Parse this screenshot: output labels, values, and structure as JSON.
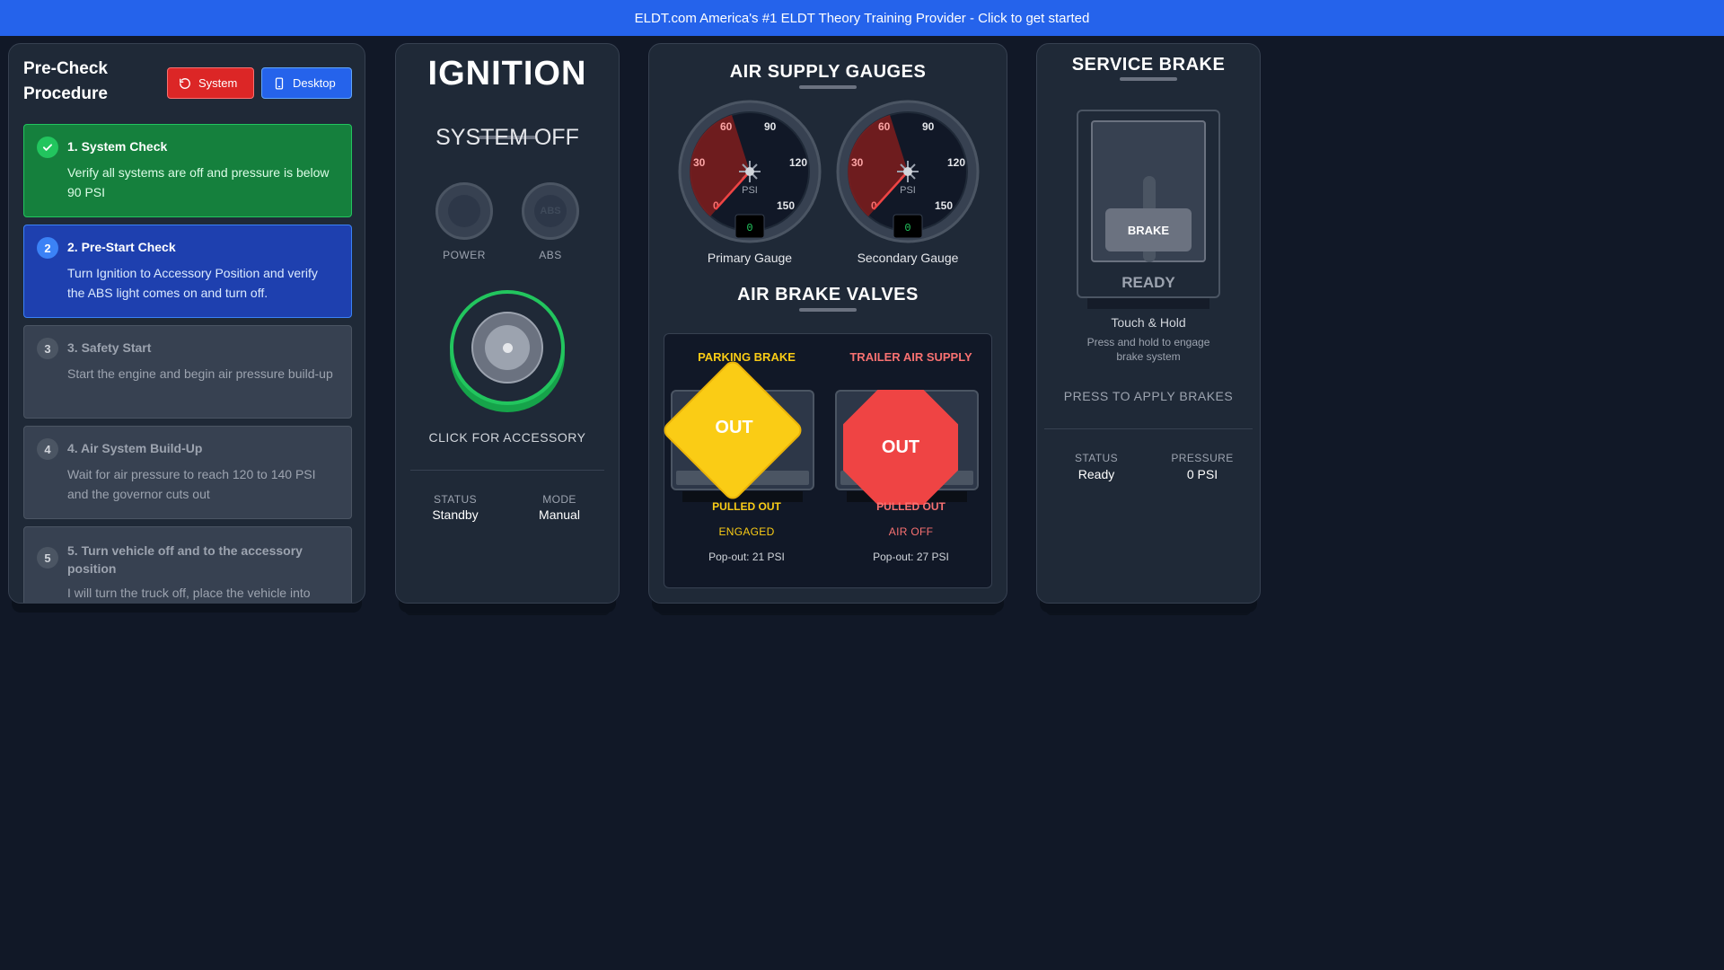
{
  "banner": {
    "text": "ELDT.com America's #1 ELDT Theory Training Provider - Click to get started"
  },
  "precheck": {
    "title": "Pre-Check Procedure",
    "system_button": "System",
    "desktop_button": "Desktop",
    "steps": [
      {
        "num": "1",
        "title": "1. System Check",
        "desc": "Verify all systems are off and pressure is below 90 PSI",
        "state": "done"
      },
      {
        "num": "2",
        "title": "2. Pre-Start Check",
        "desc": "Turn Ignition to Accessory Position and verify the ABS light comes on and turn off.",
        "state": "active"
      },
      {
        "num": "3",
        "title": "3. Safety Start",
        "desc": "Start the engine and begin air pressure build-up",
        "state": "pending"
      },
      {
        "num": "4",
        "title": "4. Air System Build-Up",
        "desc": "Wait for air pressure to reach 120 to 140 PSI and the governor cuts out",
        "state": "pending"
      },
      {
        "num": "5",
        "title": "5. Turn vehicle off and to the accessory position",
        "desc": "I will turn the truck off, place the vehicle into",
        "state": "pending"
      }
    ]
  },
  "ignition": {
    "title": "IGNITION",
    "system_state": "SYSTEM OFF",
    "power_label": "POWER",
    "abs_label": "ABS",
    "abs_icon_text": "ABS",
    "hint": "CLICK FOR ACCESSORY",
    "status_label": "STATUS",
    "status_value": "Standby",
    "mode_label": "MODE",
    "mode_value": "Manual"
  },
  "air_supply": {
    "title": "AIR SUPPLY GAUGES",
    "unit": "PSI",
    "tick_labels": [
      "0",
      "30",
      "60",
      "90",
      "120",
      "150"
    ],
    "gauges": [
      {
        "label": "Primary Gauge",
        "value": "0"
      },
      {
        "label": "Secondary Gauge",
        "value": "0"
      }
    ]
  },
  "valves": {
    "title": "AIR BRAKE VALVES",
    "parking": {
      "title": "PARKING BRAKE",
      "knob": "OUT",
      "status": "PULLED OUT",
      "state": "ENGAGED",
      "popout": "Pop-out: 21 PSI"
    },
    "trailer": {
      "title": "TRAILER AIR SUPPLY",
      "knob": "OUT",
      "status": "PULLED OUT",
      "state": "AIR OFF",
      "popout": "Pop-out: 27 PSI"
    }
  },
  "service_brake": {
    "title": "SERVICE BRAKE",
    "pedal_label": "BRAKE",
    "ready": "READY",
    "touch": "Touch & Hold",
    "touch_sub": "Press and hold to engage brake system",
    "press": "PRESS TO APPLY BRAKES",
    "status_label": "STATUS",
    "status_value": "Ready",
    "pressure_label": "PRESSURE",
    "pressure_value": "0 PSI"
  },
  "colors": {
    "parking": "#facc15",
    "trailer": "#f87171",
    "green": "#22c55e",
    "blue": "#2563eb",
    "red": "#dc2626"
  }
}
